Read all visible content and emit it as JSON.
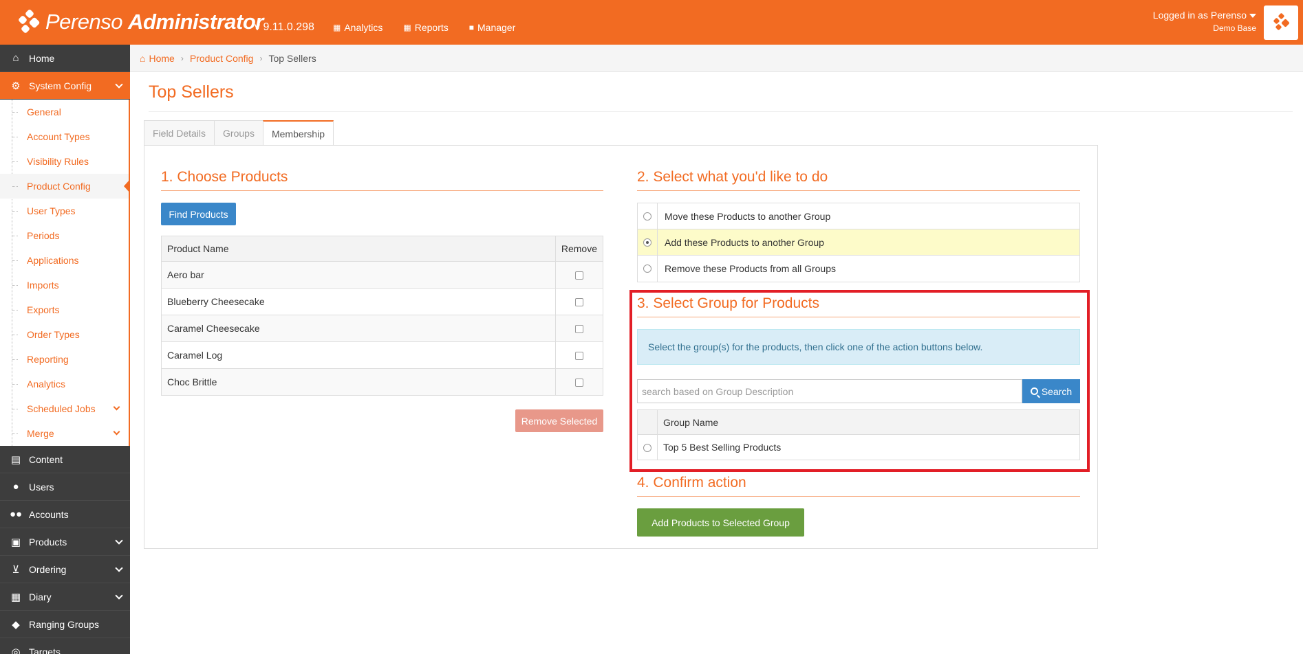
{
  "brand": {
    "name": "Perenso",
    "suffix": "Administrator"
  },
  "version": "v 9.11.0.298",
  "topnav": [
    {
      "label": "Analytics",
      "icon": "chart-icon"
    },
    {
      "label": "Reports",
      "icon": "table-icon"
    },
    {
      "label": "Manager",
      "icon": "briefcase-icon"
    }
  ],
  "user": {
    "logged_in": "Logged in as Perenso",
    "base": "Demo Base"
  },
  "sidebar": {
    "home": "Home",
    "system_config": "System Config",
    "sub": [
      "General",
      "Account Types",
      "Visibility Rules",
      "Product Config",
      "User Types",
      "Periods",
      "Applications",
      "Imports",
      "Exports",
      "Order Types",
      "Reporting",
      "Analytics",
      "Scheduled Jobs",
      "Merge"
    ],
    "rest": [
      "Content",
      "Users",
      "Accounts",
      "Products",
      "Ordering",
      "Diary",
      "Ranging Groups",
      "Targets"
    ]
  },
  "breadcrumb": [
    "Home",
    "Product Config",
    "Top Sellers"
  ],
  "page_title": "Top Sellers",
  "tabs": [
    "Field Details",
    "Groups",
    "Membership"
  ],
  "section1": {
    "title": "1. Choose Products",
    "find_button": "Find Products",
    "col_name": "Product Name",
    "col_remove": "Remove",
    "products": [
      "Aero bar",
      "Blueberry Cheesecake",
      "Caramel Cheesecake",
      "Caramel Log",
      "Choc Brittle"
    ],
    "remove_button": "Remove Selected"
  },
  "section2": {
    "title": "2. Select what you'd like to do",
    "options": [
      "Move these Products to another Group",
      "Add these Products to another Group",
      "Remove these Products from all Groups"
    ],
    "selected_index": 1
  },
  "section3": {
    "title": "3. Select Group for Products",
    "info": "Select the group(s) for the products, then click one of the action buttons below.",
    "search_placeholder": "search based on Group Description",
    "search_button": "Search",
    "col_group": "Group Name",
    "groups": [
      "Top 5 Best Selling Products"
    ]
  },
  "section4": {
    "title": "4. Confirm action",
    "confirm_button": "Add Products to Selected Group"
  },
  "colors": {
    "brand": "#f26b22",
    "sidebar": "#3d3d3d",
    "highlight": "#e21e26"
  }
}
